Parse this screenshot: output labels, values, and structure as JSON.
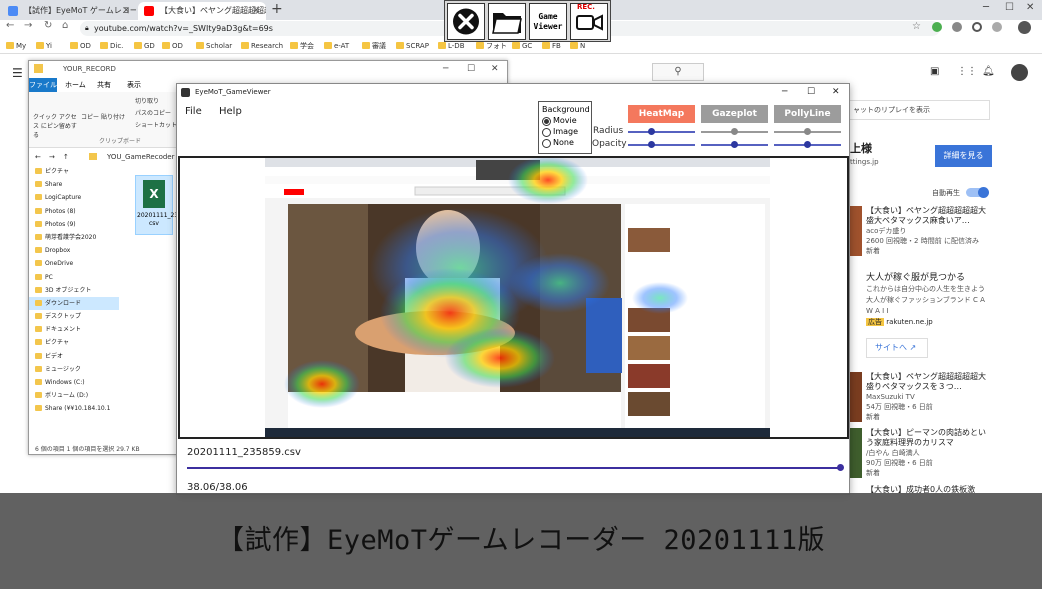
{
  "browser": {
    "tabs": [
      {
        "label": "【試作】EyeMoT ゲームレコーダー | ホ",
        "favicon_color": "#4c8bf5"
      },
      {
        "label": "【大食い】ペヤング超超超超超大",
        "favicon_color": "#ff0000"
      }
    ],
    "new_tab": "+",
    "url": "youtube.com/watch?v=_SWIty9aD3g&t=69s",
    "bookmarks": [
      "My",
      "Yi",
      "OD",
      "Dic.",
      "GD",
      "OD",
      "Scholar",
      "Research",
      "学会",
      "e-AT",
      "審議",
      "SCRAP",
      "L-DB",
      "フォト",
      "GC",
      "FB",
      "N"
    ]
  },
  "recorder_toolbar": {
    "buttons": [
      {
        "name": "close",
        "label": ""
      },
      {
        "name": "folder",
        "label": ""
      },
      {
        "name": "game-viewer",
        "label": "Game\nViewer"
      },
      {
        "name": "rec",
        "label": "REC."
      }
    ],
    "game_viewer_label_1": "Game",
    "game_viewer_label_2": "Viewer",
    "rec_label": "REC."
  },
  "explorer": {
    "title": "YOUR_RECORD",
    "ribbon_tabs": [
      "ファイル",
      "ホーム",
      "共有",
      "表示"
    ],
    "ribbon_items": [
      "クイック アクセス にピン留めする",
      "コピー",
      "貼り付け",
      "切り取り",
      "パスのコピー",
      "ショートカットの貼"
    ],
    "ribbon_group": "クリップボード",
    "path": "YOU_GameRecoder",
    "nav": [
      "ピクチャ",
      "Share",
      "LogiCapture",
      "Photos (8)",
      "Photos (9)",
      "萌芽看護学会2020",
      "Dropbox",
      "OneDrive",
      "PC",
      "3D オブジェクト",
      "ダウンロード",
      "デスクトップ",
      "ドキュメント",
      "ピクチャ",
      "ビデオ",
      "ミュージック",
      "Windows (C:)",
      "ボリューム (D:)",
      "Share (¥¥10.184.10.1"
    ],
    "file_name": "20201111_235859.csv",
    "file_label_line1": "20201111_23",
    "file_label_line2": "csv",
    "status": "6 個の項目   1 個の項目を選択  29.7 KB"
  },
  "viewer": {
    "title": "EyeMoT_GameViewer",
    "menu": [
      "File",
      "Help"
    ],
    "background": {
      "legend": "Background",
      "options": [
        "Movie",
        "Image",
        "None"
      ],
      "selected": "Movie"
    },
    "modes": [
      {
        "label": "HeatMap",
        "color": "#f4785d"
      },
      {
        "label": "Gazeplot",
        "color": "#9c9c9c"
      },
      {
        "label": "PollyLine",
        "color": "#9c9c9c"
      }
    ],
    "radius_label": "Radius",
    "opacity_label": "Opacity",
    "sliders": {
      "heatmap_radius": 0.35,
      "heatmap_opacity": 0.35,
      "gazeplot_radius": 0.5,
      "gazeplot_opacity": 0.5,
      "polly_radius": 0.5,
      "polly_opacity": 0.5
    },
    "file": "20201111_235859.csv",
    "progress": 1.0,
    "time": "38.06/38.06"
  },
  "youtube_side": {
    "ad_top_text": "ャットのリプレイを表示",
    "ad_title": "上様",
    "ad_domain": "ttings.jp",
    "detail_button": "詳細を見る",
    "autoplay": "自動再生",
    "videos": [
      {
        "title": "【大食い】ペヤング超超超超超大盛大ペタマックス麻食いア…",
        "channel": "acoデカ盛り",
        "meta": "2600 回視聴・2 時間前 に配信済み",
        "badge": "新着"
      },
      {
        "title": "【大食い】ペヤング超超超超超大盛りペタマックスを３つ…",
        "channel": "MaxSuzuki TV",
        "meta": "54万 回視聴・6 日前",
        "badge": "新着"
      },
      {
        "title": "【大食い】ピーマンの肉詰めという家庭料理界のカリスマ",
        "channel": "/白やん 白崎満人",
        "meta": "90万 回視聴・6 日前",
        "badge": "新着"
      },
      {
        "title": "【大食い】成功者0人の鉄板激",
        "channel": "",
        "meta": "",
        "badge": ""
      }
    ],
    "ad2_title": "大人が稼ぐ服が見つかる",
    "ad2_desc": "これからは自分中心の人生を生きよう大人が稼ぐファッションブランド C A W A I I",
    "ad2_tag": "広告",
    "ad2_domain": "rakuten.ne.jp",
    "ad2_link": "サイトへ"
  },
  "caption": "【試作】EyeMoTゲームレコーダー 20201111版"
}
